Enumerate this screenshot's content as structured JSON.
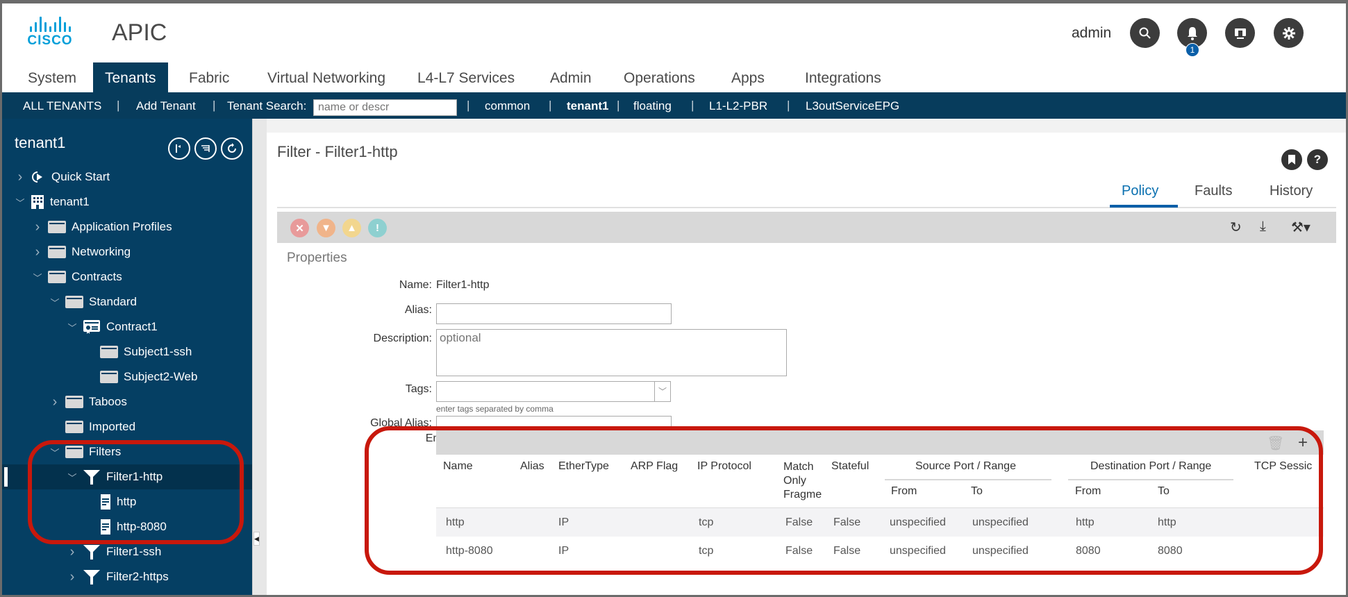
{
  "header": {
    "brand": "CISCO",
    "app_title": "APIC",
    "user": "admin",
    "notification_count": "1",
    "icons": [
      "search-icon",
      "bell-icon",
      "display-icon",
      "gear-icon"
    ]
  },
  "main_nav": {
    "tabs": [
      {
        "label": "System",
        "active": false
      },
      {
        "label": "Tenants",
        "active": true
      },
      {
        "label": "Fabric",
        "active": false
      },
      {
        "label": "Virtual Networking",
        "active": false
      },
      {
        "label": "L4-L7 Services",
        "active": false
      },
      {
        "label": "Admin",
        "active": false
      },
      {
        "label": "Operations",
        "active": false
      },
      {
        "label": "Apps",
        "active": false
      },
      {
        "label": "Integrations",
        "active": false
      }
    ]
  },
  "sub_nav": {
    "all_tenants": "ALL TENANTS",
    "add_tenant": "Add Tenant",
    "search_label": "Tenant Search:",
    "search_placeholder": "name or descr",
    "tenants": [
      "common",
      "tenant1",
      "floating",
      "L1-L2-PBR",
      "L3outServiceEPG"
    ],
    "active_tenant": "tenant1"
  },
  "sidebar": {
    "title": "tenant1",
    "tools": [
      "pin-icon",
      "list-filter-icon",
      "refresh-icon"
    ],
    "tree": [
      {
        "label": "Quick Start",
        "icon": "quickstart",
        "chev": ">",
        "level": 0
      },
      {
        "label": "tenant1",
        "icon": "building",
        "chev": "v",
        "level": 0
      },
      {
        "label": "Application Profiles",
        "icon": "folder",
        "chev": ">",
        "level": 1
      },
      {
        "label": "Networking",
        "icon": "folder",
        "chev": ">",
        "level": 1
      },
      {
        "label": "Contracts",
        "icon": "folder",
        "chev": "v",
        "level": 1
      },
      {
        "label": "Standard",
        "icon": "folder",
        "chev": "v",
        "level": 2
      },
      {
        "label": "Contract1",
        "icon": "contract",
        "chev": "v",
        "level": 3
      },
      {
        "label": "Subject1-ssh",
        "icon": "folder",
        "chev": "",
        "level": 4
      },
      {
        "label": "Subject2-Web",
        "icon": "folder",
        "chev": "",
        "level": 4
      },
      {
        "label": "Taboos",
        "icon": "folder",
        "chev": ">",
        "level": 2
      },
      {
        "label": "Imported",
        "icon": "folder",
        "chev": "",
        "level": 2
      },
      {
        "label": "Filters",
        "icon": "folder",
        "chev": "v",
        "level": 2
      },
      {
        "label": "Filter1-http",
        "icon": "filter",
        "chev": "v",
        "level": 3,
        "selected": true
      },
      {
        "label": "http",
        "icon": "entry",
        "chev": "",
        "level": 4
      },
      {
        "label": "http-8080",
        "icon": "entry",
        "chev": "",
        "level": 4
      },
      {
        "label": "Filter1-ssh",
        "icon": "filter",
        "chev": ">",
        "level": 3
      },
      {
        "label": "Filter2-https",
        "icon": "filter",
        "chev": ">",
        "level": 3
      }
    ]
  },
  "content": {
    "title": "Filter - Filter1-http",
    "tabs": [
      {
        "label": "Policy",
        "active": true
      },
      {
        "label": "Faults",
        "active": false
      },
      {
        "label": "History",
        "active": false
      }
    ],
    "fault_colors": {
      "critical": "#e89a9a",
      "major": "#f0b48a",
      "minor": "#f2d68e",
      "warning": "#8ed0d0"
    },
    "section": "Properties",
    "form": {
      "name_label": "Name:",
      "name_value": "Filter1-http",
      "alias_label": "Alias:",
      "alias_value": "",
      "description_label": "Description:",
      "description_placeholder": "optional",
      "tags_label": "Tags:",
      "tags_value": "",
      "tags_hint": "enter tags separated by comma",
      "global_alias_label": "Global Alias:",
      "global_alias_value": "",
      "entries_label": "Entries:"
    },
    "entries": {
      "columns": {
        "name": "Name",
        "alias": "Alias",
        "ethertype": "EtherType",
        "arp_flag": "ARP Flag",
        "ip_protocol": "IP Protocol",
        "match_only_frag": "Match Only Fragme",
        "stateful": "Stateful",
        "source_group": "Source Port / Range",
        "dest_group": "Destination Port / Range",
        "from": "From",
        "to": "To",
        "tcp_session": "TCP Sessic"
      },
      "rows": [
        {
          "name": "http",
          "alias": "",
          "ethertype": "IP",
          "arp_flag": "",
          "ip_protocol": "tcp",
          "match_only_frag": "False",
          "stateful": "False",
          "src_from": "unspecified",
          "src_to": "unspecified",
          "dst_from": "http",
          "dst_to": "http"
        },
        {
          "name": "http-8080",
          "alias": "",
          "ethertype": "IP",
          "arp_flag": "",
          "ip_protocol": "tcp",
          "match_only_frag": "False",
          "stateful": "False",
          "src_from": "unspecified",
          "src_to": "unspecified",
          "dst_from": "8080",
          "dst_to": "8080"
        }
      ]
    }
  },
  "colors": {
    "nav_dark": "#073c5c",
    "sidebar_bg": "#053f63",
    "accent": "#0a5fa8",
    "highlight": "#c8180c",
    "cisco_blue": "#049fd9"
  }
}
